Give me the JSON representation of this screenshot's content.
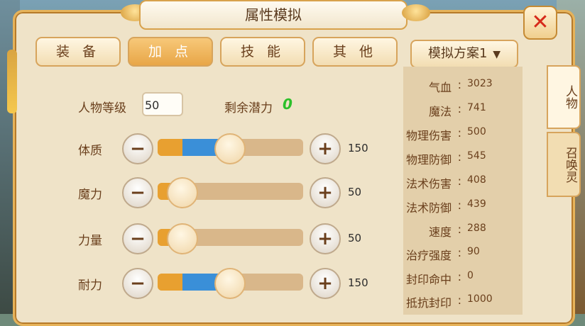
{
  "window": {
    "title": "属性模拟",
    "close_icon": "close-x-icon"
  },
  "tabs": [
    {
      "label": "装 备",
      "active": false
    },
    {
      "label": "加 点",
      "active": true
    },
    {
      "label": "技 能",
      "active": false
    },
    {
      "label": "其 他",
      "active": false
    }
  ],
  "plan_select": {
    "value": "模拟方案1",
    "icon": "chevron-down-icon"
  },
  "side_tabs": [
    {
      "label": "人物",
      "active": true
    },
    {
      "label": "召唤灵",
      "active": false
    }
  ],
  "level": {
    "label": "人物等级",
    "value": "50"
  },
  "potential": {
    "label": "剩余潜力",
    "value": "0"
  },
  "attributes": [
    {
      "label": "体质",
      "value": "150",
      "fill_fraction": 0.49,
      "base_fraction": 0.17
    },
    {
      "label": "魔力",
      "value": "50",
      "fill_fraction": 0.16,
      "base_fraction": 0.16
    },
    {
      "label": "力量",
      "value": "50",
      "fill_fraction": 0.16,
      "base_fraction": 0.16
    },
    {
      "label": "耐力",
      "value": "150",
      "fill_fraction": 0.49,
      "base_fraction": 0.17
    }
  ],
  "stats": [
    {
      "label": "气血",
      "value": "3023"
    },
    {
      "label": "魔法",
      "value": "741"
    },
    {
      "label": "物理伤害",
      "value": "500"
    },
    {
      "label": "物理防御",
      "value": "545"
    },
    {
      "label": "法术伤害",
      "value": "408"
    },
    {
      "label": "法术防御",
      "value": "439"
    },
    {
      "label": "速度",
      "value": "288"
    },
    {
      "label": "治疗强度",
      "value": "90"
    },
    {
      "label": "封印命中",
      "value": "0"
    },
    {
      "label": "抵抗封印",
      "value": "1000"
    }
  ],
  "colors": {
    "accent_orange": "#e8a030",
    "accent_blue": "#3a8fd8",
    "close_red": "#d62a1a",
    "potential_green": "#2cc02a"
  }
}
